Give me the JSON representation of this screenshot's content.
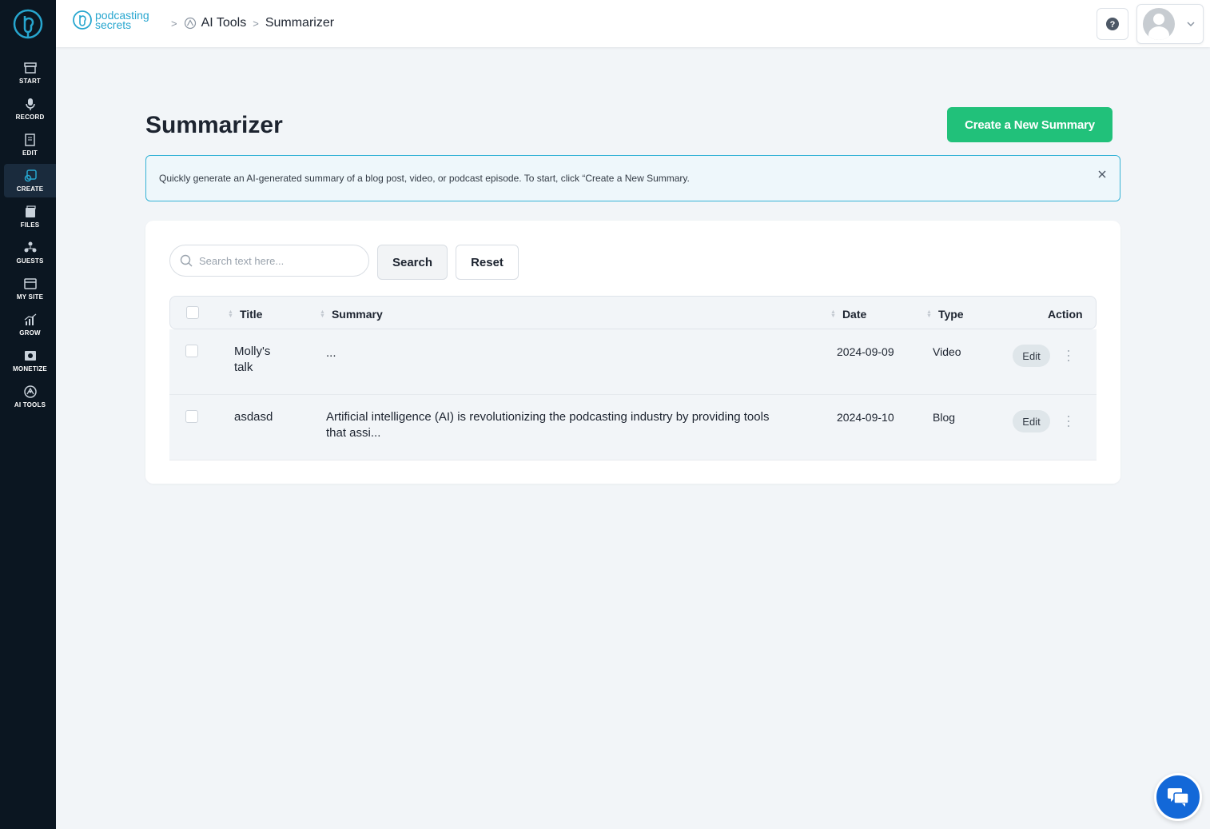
{
  "brand": {
    "line1": "podcasting",
    "line2": "secrets"
  },
  "breadcrumb": {
    "section": "AI Tools",
    "current": "Summarizer"
  },
  "sidebar": {
    "items": [
      {
        "label": "START",
        "icon": "store-icon"
      },
      {
        "label": "RECORD",
        "icon": "microphone-icon"
      },
      {
        "label": "EDIT",
        "icon": "edit-icon"
      },
      {
        "label": "CREATE",
        "icon": "create-icon",
        "active": true
      },
      {
        "label": "FILES",
        "icon": "files-icon"
      },
      {
        "label": "GUESTS",
        "icon": "guests-icon"
      },
      {
        "label": "MY SITE",
        "icon": "website-icon"
      },
      {
        "label": "GROW",
        "icon": "chart-icon"
      },
      {
        "label": "MONETIZE",
        "icon": "monetize-icon"
      },
      {
        "label": "AI TOOLS",
        "icon": "ai-tools-icon"
      }
    ]
  },
  "page": {
    "title": "Summarizer",
    "create_button": "Create a New Summary",
    "info_text": "Quickly generate an AI-generated summary of a blog post, video, or podcast episode. To start, click “Create a New Summary."
  },
  "search": {
    "placeholder": "Search text here...",
    "search_label": "Search",
    "reset_label": "Reset"
  },
  "table": {
    "columns": {
      "title": "Title",
      "summary": "Summary",
      "date": "Date",
      "type": "Type",
      "action": "Action"
    },
    "rows": [
      {
        "title_line1": "Molly's",
        "title_line2": "talk",
        "summary_line1": "...",
        "summary_line2": "",
        "date": "2024-09-09",
        "type": "Video",
        "action": "Edit"
      },
      {
        "title_line1": "asdasd",
        "title_line2": "",
        "summary_line1": "Artificial intelligence (AI) is revolutionizing the podcasting industry by providing tools",
        "summary_line2": "that assi...",
        "date": "2024-09-10",
        "type": "Blog",
        "action": "Edit"
      }
    ]
  },
  "colors": {
    "sidebar_bg": "#0b1621",
    "accent_green": "#21c17a",
    "info_border": "#36b3d6",
    "brand_blue": "#27a6cf",
    "chat_blue": "#1368d8"
  }
}
